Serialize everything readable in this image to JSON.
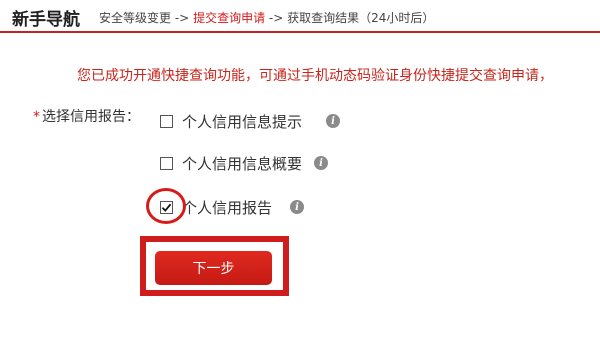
{
  "header": {
    "title": "新手导航",
    "steps": [
      {
        "label": "安全等级变更",
        "active": false
      },
      {
        "label": "提交查询申请",
        "active": true
      },
      {
        "label": "获取查询结果（24小时后）",
        "active": false
      }
    ],
    "arrow": "->"
  },
  "notice": "您已成功开通快捷查询功能，可通过手机动态码验证身份快捷提交查询申请，",
  "form": {
    "required_mark": "*",
    "label": "选择信用报告：",
    "options": [
      {
        "label": "个人信用信息提示",
        "checked": false,
        "info_icon": "info-icon"
      },
      {
        "label": "个人信用信息概要",
        "checked": false,
        "info_icon": "info-icon"
      },
      {
        "label": "个人信用报告",
        "checked": true,
        "info_icon": "info-icon"
      }
    ],
    "next_button": "下一步"
  },
  "colors": {
    "accent": "#d71a1a",
    "notice": "#c8261d",
    "button": "#d0211a"
  }
}
